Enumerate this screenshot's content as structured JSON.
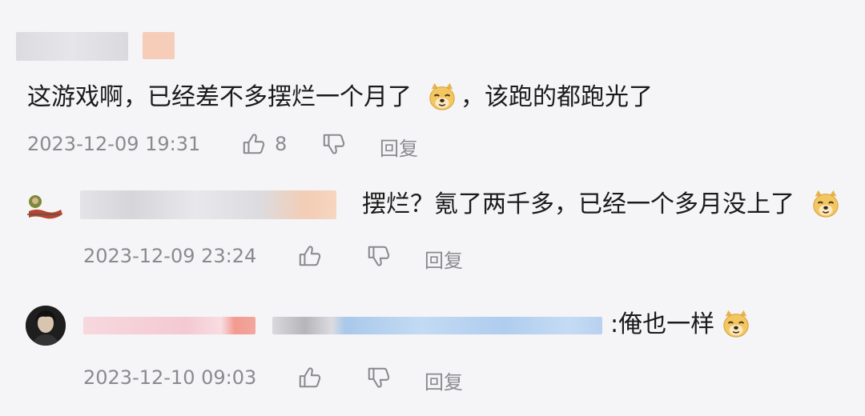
{
  "comments": [
    {
      "text_a": "这游戏啊，已经差不多摆烂一个月了",
      "text_b": "，该跑的都跑光了",
      "time": "2023-12-09 19:31",
      "likes": "8",
      "reply_label": "回复"
    },
    {
      "text_a": "摆烂？氪了两千多，已经一个多月没上了",
      "time": "2023-12-09 23:24",
      "reply_label": "回复"
    },
    {
      "text_a": ":俺也一样",
      "time": "2023-12-10 09:03",
      "reply_label": "回复"
    }
  ],
  "colors": {
    "background": "#f5f5f7",
    "meta_text": "#8a8a8f",
    "emoji_face": "#f2c661"
  },
  "icons": [
    "thumbs-up-icon",
    "thumbs-down-icon",
    "doge-emoji-icon"
  ]
}
